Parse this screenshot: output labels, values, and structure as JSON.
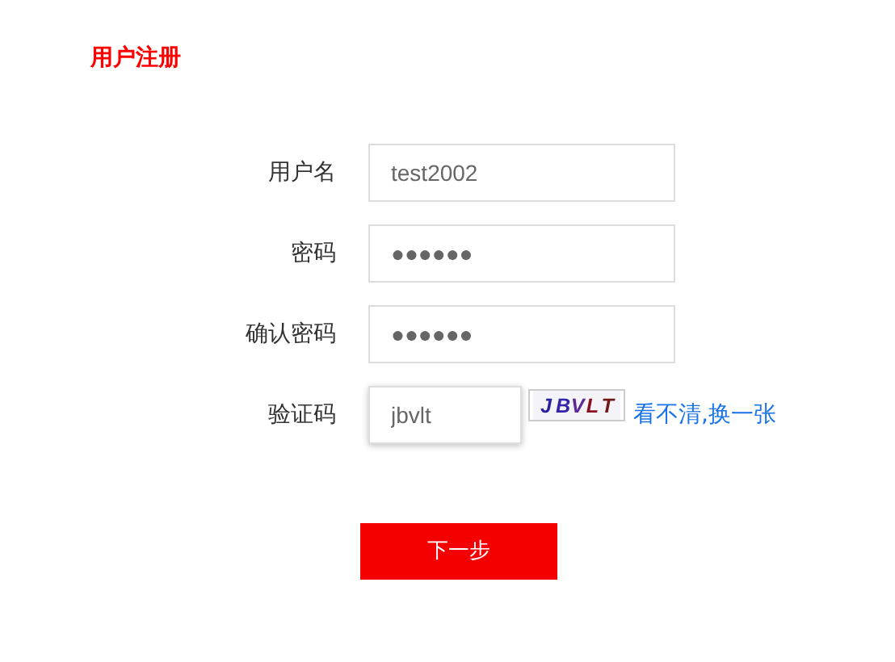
{
  "title": "用户注册",
  "fields": [
    {
      "label": "用户名",
      "value": "test2002",
      "kind": "text",
      "focused": false
    },
    {
      "label": "密码",
      "value": "●●●●●●",
      "kind": "text",
      "focused": false
    },
    {
      "label": "确认密码",
      "value": "●●●●●●",
      "kind": "text",
      "focused": false
    },
    {
      "label": "验证码",
      "value": "jbvlt",
      "kind": "captcha",
      "focused": true,
      "captcha": "JBVLT",
      "refresh_link": "看不清,换一张"
    }
  ],
  "submit": "下一步"
}
